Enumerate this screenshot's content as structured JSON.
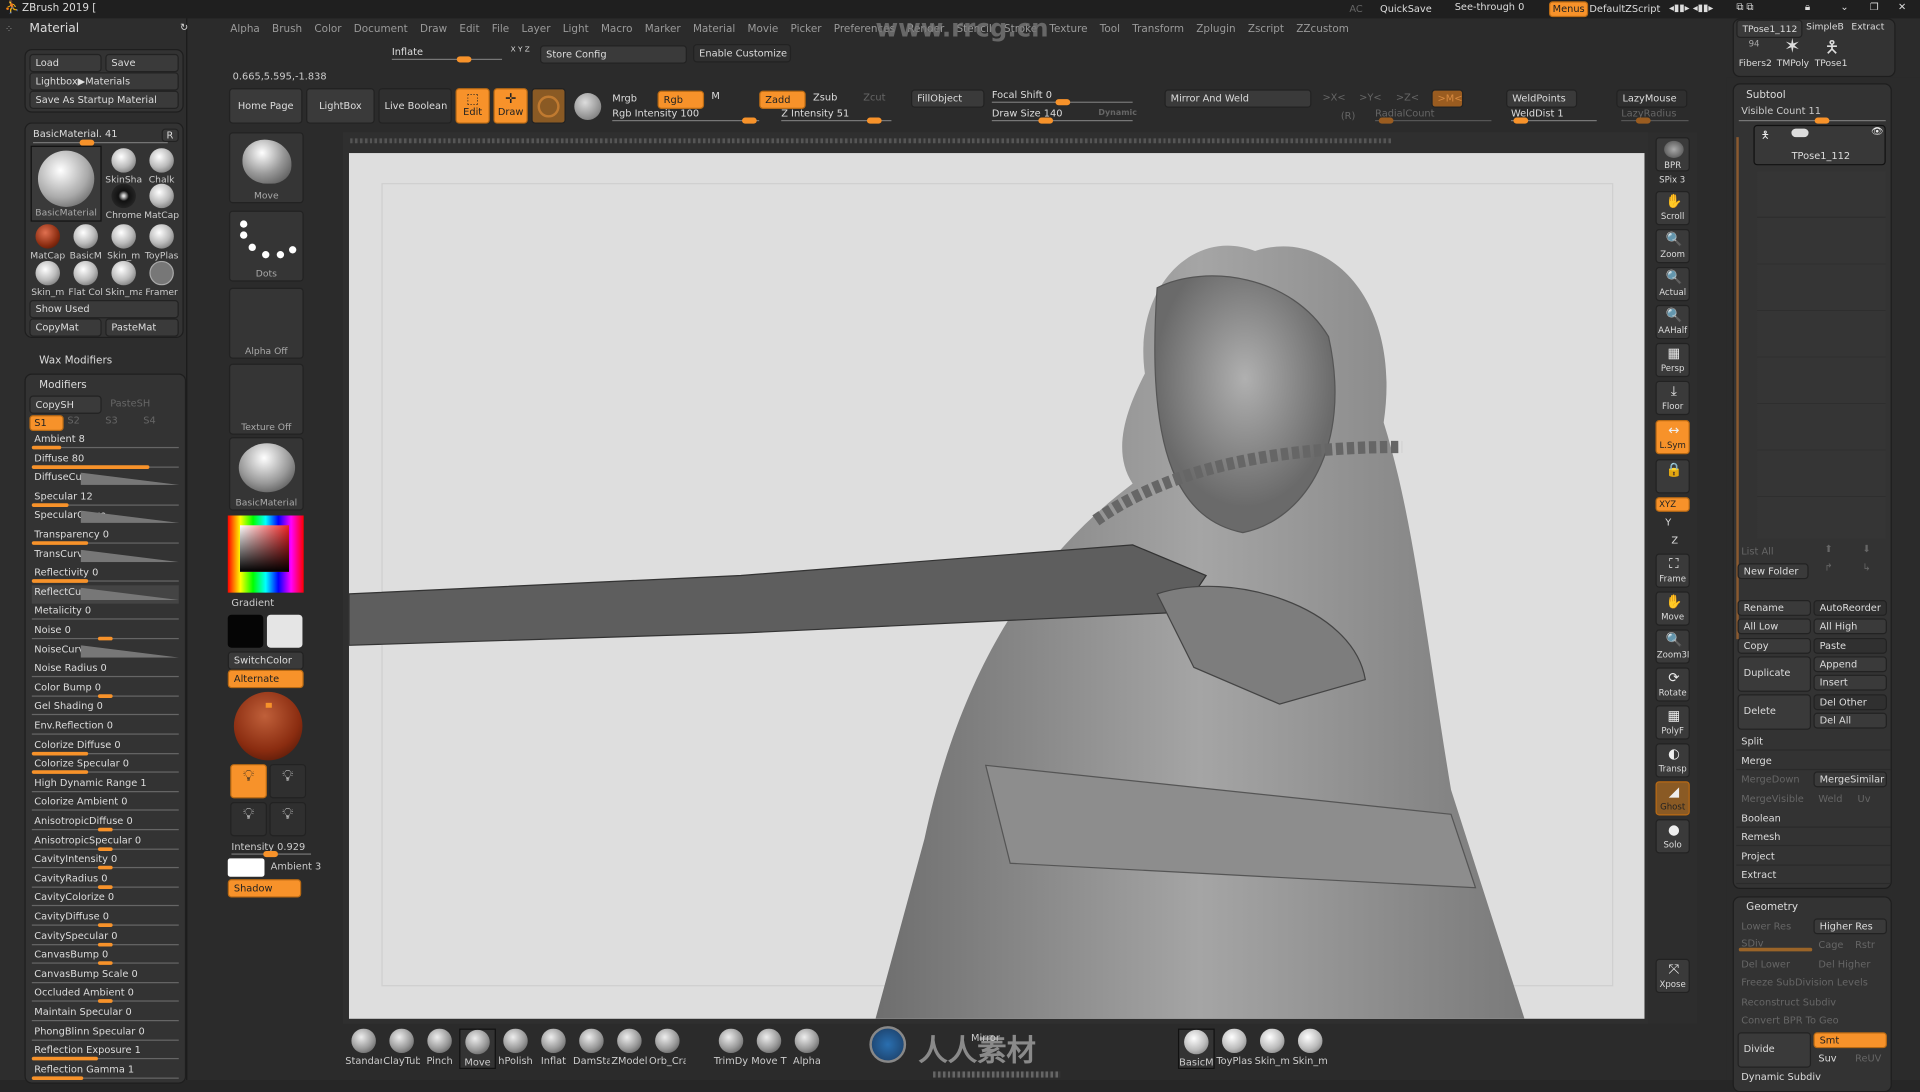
{
  "titlebar": {
    "title": "ZBrush 2019 [",
    "ac": "AC",
    "quicksave": "QuickSave",
    "see_through": "See-through  0",
    "menus": "Menus",
    "script": "DefaultZScript"
  },
  "menu": [
    "Alpha",
    "Brush",
    "Color",
    "Document",
    "Draw",
    "Edit",
    "File",
    "Layer",
    "Light",
    "Macro",
    "Marker",
    "Material",
    "Movie",
    "Picker",
    "Preferences",
    "Render",
    "Stencil",
    "Stroke",
    "Texture",
    "Tool",
    "Transform",
    "Zplugin",
    "Zscript",
    "ZZcustom"
  ],
  "watermark_url": "www.rrcg.cn",
  "top": {
    "inflate": "Inflate",
    "xyz": "X Y Z",
    "store_config": "Store Config",
    "enable_customize": "Enable Customize",
    "coords": "0.665,5.595,-1.838",
    "home_page": "Home Page",
    "lightbox": "LightBox",
    "live_boolean": "Live Boolean",
    "edit": "Edit",
    "draw": "Draw",
    "mrgb": "Mrgb",
    "rgb": "Rgb",
    "m": "M",
    "zadd": "Zadd",
    "zsub": "Zsub",
    "zcut": "Zcut",
    "rgb_intensity": "Rgb Intensity 100",
    "z_intensity": "Z Intensity 51",
    "fill_object": "FillObject",
    "focal_shift": "Focal Shift 0",
    "draw_size": "Draw Size 140",
    "dynamic": "Dynamic",
    "mirror_weld": "Mirror And Weld",
    "sym_x": ">X<",
    "sym_y": ">Y<",
    "sym_z": ">Z<",
    "sym_m": ">M<",
    "r": "(R)",
    "radial_count": "RadialCount",
    "weld_points": "WeldPoints",
    "weld_dist": "WeldDist 1",
    "lazy_mouse": "LazyMouse",
    "lazy_radius": "LazyRadius",
    "tool_thumb_1": "TPose1_112",
    "tool_thumb_2": "SimpleB",
    "extract": "Extract",
    "fibers_count": "94",
    "fibers": "Fibers2",
    "tmpoly": "TMPoly",
    "tpose": "TPose1"
  },
  "left": {
    "title": "Material",
    "load": "Load",
    "save": "Save",
    "lightbox_materials": "Lightbox▶Materials",
    "save_startup": "Save As Startup Material",
    "current_material": "BasicMaterial. 41",
    "r": "R",
    "big_label": "BasicMaterial",
    "materials": [
      "SkinSha",
      "Chalk",
      "Chrome",
      "MatCap",
      "MatCap",
      "BasicM",
      "Skin_m",
      "ToyPlas",
      "Skin_m",
      "Flat Col",
      "Skin_ma",
      "Framer"
    ],
    "show_used": "Show Used",
    "copy_mat": "CopyMat",
    "paste_mat": "PasteMat",
    "wax_modifiers": "Wax Modifiers",
    "modifiers": "Modifiers",
    "copy_sh": "CopySH",
    "paste_sh": "PasteSH",
    "shaders": [
      "S1",
      "S2",
      "S3",
      "S4"
    ],
    "mods": [
      {
        "label": "Ambient  8",
        "fill": 0.2
      },
      {
        "label": "Diffuse  80",
        "fill": 0.8
      },
      {
        "label": "DiffuseCurve",
        "curve": true
      },
      {
        "label": "Specular  12",
        "fill": 0.25
      },
      {
        "label": "SpecularCurve",
        "curve": true
      },
      {
        "label": "Transparency  0",
        "fill": 0.38
      },
      {
        "label": "TransCurve",
        "curve": true
      },
      {
        "label": "Reflectivity  0",
        "fill": 0.38
      },
      {
        "label": "ReflectCurve",
        "curve": true
      },
      {
        "label": "Metalicity  0"
      },
      {
        "label": "Noise  0",
        "knob": 0.5
      },
      {
        "label": "NoiseCurve",
        "curve": true
      },
      {
        "label": "Noise Radius  0"
      },
      {
        "label": "Color Bump  0",
        "knob": 0.5
      },
      {
        "label": "Gel Shading  0"
      },
      {
        "label": "Env.Reflection  0"
      },
      {
        "label": "Colorize Diffuse  0",
        "fill": 0.38
      },
      {
        "label": "Colorize Specular  0",
        "fill": 0.38
      },
      {
        "label": "High Dynamic Range  1"
      },
      {
        "label": "Colorize Ambient  0"
      },
      {
        "label": "AnisotropicDiffuse  0",
        "knob": 0.5
      },
      {
        "label": "AnisotropicSpecular  0",
        "knob": 0.5
      },
      {
        "label": "CavityIntensity  0",
        "knob": 0.5
      },
      {
        "label": "CavityRadius  0",
        "knob": 0.5
      },
      {
        "label": "CavityColorize  0"
      },
      {
        "label": "CavityDiffuse  0",
        "knob": 0.5
      },
      {
        "label": "CavitySpecular  0",
        "knob": 0.5
      },
      {
        "label": "CanvasBump  0",
        "knob": 0.5
      },
      {
        "label": "CanvasBump Scale  0"
      },
      {
        "label": "Occluded  Ambient  0",
        "knob": 0.5
      },
      {
        "label": "Maintain Specular  0"
      },
      {
        "label": "PhongBlinn Specular  0"
      },
      {
        "label": "Reflection Exposure  1",
        "fill": 0.45
      },
      {
        "label": "Reflection Gamma  1",
        "fill": 0.35
      }
    ]
  },
  "toolcol": {
    "brush": "Move",
    "stroke": "Dots",
    "alpha": "Alpha Off",
    "texture": "Texture Off",
    "material": "BasicMaterial",
    "gradient": "Gradient",
    "switch_color": "SwitchColor",
    "alternate": "Alternate",
    "intensity": "Intensity 0.929",
    "ambient": "Ambient 3",
    "shadow": "Shadow"
  },
  "dock": [
    {
      "label": "SPix 3",
      "icon": "bpr-icon",
      "glyph": "●"
    },
    {
      "label": "Scroll",
      "icon": "hand-icon",
      "glyph": "✋"
    },
    {
      "label": "Zoom",
      "icon": "zoom-icon",
      "glyph": "🔍"
    },
    {
      "label": "Actual",
      "icon": "actual-icon",
      "glyph": "🔍"
    },
    {
      "label": "AAHalf",
      "icon": "aahalf-icon",
      "glyph": "🔍"
    },
    {
      "label": "Persp",
      "icon": "persp-icon",
      "glyph": "▦"
    },
    {
      "label": "Floor",
      "icon": "floor-icon",
      "glyph": "⤓"
    },
    {
      "label": "L.Sym",
      "icon": "lsym-icon",
      "glyph": "↔",
      "on": true
    },
    {
      "label": "",
      "icon": "camera-lock-icon",
      "glyph": "🔒"
    },
    {
      "label": "Frame",
      "icon": "frame-icon",
      "glyph": "⛶"
    },
    {
      "label": "Move",
      "icon": "move-icon",
      "glyph": "✋"
    },
    {
      "label": "Zoom3D",
      "icon": "zoom3d-icon",
      "glyph": "🔍"
    },
    {
      "label": "Rotate",
      "icon": "rotate-icon",
      "glyph": "⟳"
    },
    {
      "label": "PolyF",
      "icon": "polyframe-icon",
      "glyph": "▦"
    },
    {
      "label": "Transp",
      "icon": "transp-icon",
      "glyph": "◐"
    },
    {
      "label": "Ghost",
      "icon": "ghost-icon",
      "glyph": "◢",
      "on": true
    },
    {
      "label": "Solo",
      "icon": "solo-icon",
      "glyph": "●"
    }
  ],
  "dock_extra": {
    "bpr": "BPR",
    "xyz": "XYZ",
    "y": "Y",
    "z": "Z",
    "xpose": "Xpose"
  },
  "subtool": {
    "title": "Subtool",
    "visible_count": "Visible Count 11",
    "item": "TPose1_112",
    "list_all": "List All",
    "new_folder": "New Folder",
    "rename": "Rename",
    "auto_reorder": "AutoReorder",
    "all_low": "All Low",
    "all_high": "All High",
    "copy": "Copy",
    "paste": "Paste",
    "duplicate": "Duplicate",
    "append": "Append",
    "insert": "Insert",
    "delete": "Delete",
    "del_other": "Del Other",
    "del_all": "Del All",
    "split": "Split",
    "merge": "Merge",
    "merge_down": "MergeDown",
    "merge_similar": "MergeSimilar",
    "merge_visible": "MergeVisible",
    "weld": "Weld",
    "uv": "Uv",
    "boolean": "Boolean",
    "remesh": "Remesh",
    "project": "Project",
    "extract": "Extract"
  },
  "geometry": {
    "title": "Geometry",
    "lower_res": "Lower Res",
    "higher_res": "Higher Res",
    "sdiv": "SDiv",
    "cage": "Cage",
    "rstr": "Rstr",
    "del_lower": "Del Lower",
    "del_higher": "Del Higher",
    "freeze": "Freeze SubDivision Levels",
    "reconstruct": "Reconstruct Subdiv",
    "convert_bpr": "Convert BPR To Geo",
    "divide": "Divide",
    "smt": "Smt",
    "suv": "Suv",
    "reuv": "ReUV",
    "dynamic_subdiv": "Dynamic Subdiv"
  },
  "bottom": {
    "brushes": [
      "Standard",
      "ClayTubes",
      "Pinch",
      "Move",
      "hPolish",
      "Inflat",
      "DamSta",
      "ZModel",
      "Orb_Cra",
      "TrimDy",
      "Move T",
      "Alpha"
    ],
    "mirror": "Mirror",
    "materials": [
      "BasicM",
      "ToyPlas",
      "Skin_m",
      "Skin_m"
    ],
    "logo_text": "人人素材"
  },
  "colors": {
    "accent": "#f7922a",
    "panel": "#333333",
    "canvas": "#dedede"
  }
}
